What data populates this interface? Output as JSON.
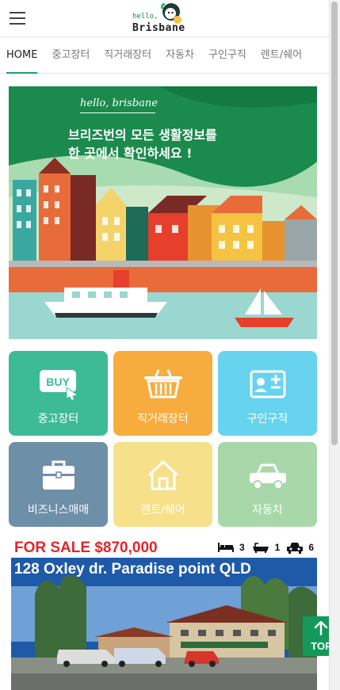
{
  "header": {
    "logo_small": "hello,",
    "logo_big": "Brisbane"
  },
  "tabs": [
    {
      "label": "HOME"
    },
    {
      "label": "중고장터"
    },
    {
      "label": "직거래장터"
    },
    {
      "label": "자동차"
    },
    {
      "label": "구인구직"
    },
    {
      "label": "렌트/쉐어"
    }
  ],
  "banner": {
    "hello": "hello, brisbane",
    "line1": "브리즈번의 모든 생활정보를",
    "line2": "한 곳에서 확인하세요 !"
  },
  "categories": [
    {
      "label": "중고장터",
      "icon": "buy-icon",
      "color": "#3dbb97"
    },
    {
      "label": "직거래장터",
      "icon": "basket-icon",
      "color": "#f7ad3e"
    },
    {
      "label": "구인구직",
      "icon": "id-card-icon",
      "color": "#67d3ee"
    },
    {
      "label": "비즈니스매매",
      "icon": "briefcase-icon",
      "color": "#6d8fa8"
    },
    {
      "label": "렌트/쉐어",
      "icon": "house-icon",
      "color": "#f6e08a"
    },
    {
      "label": "자동차",
      "icon": "car-icon",
      "color": "#a8d8a9"
    }
  ],
  "listing": {
    "sale": "FOR SALE $870,000",
    "beds": "3",
    "baths": "1",
    "cars": "6",
    "address": "128 Oxley dr. Paradise point QLD"
  },
  "top_button": {
    "label": "TOP"
  }
}
